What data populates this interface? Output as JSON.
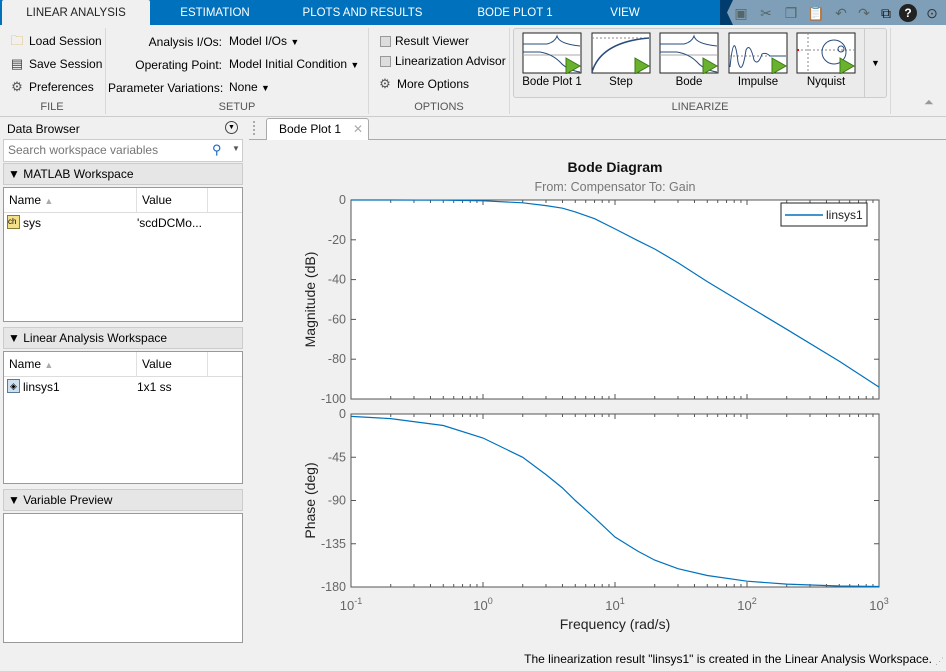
{
  "tabs": [
    {
      "label": "LINEAR ANALYSIS",
      "selected": true
    },
    {
      "label": "ESTIMATION"
    },
    {
      "label": "PLOTS AND RESULTS"
    },
    {
      "label": "BODE PLOT 1"
    },
    {
      "label": "VIEW"
    }
  ],
  "quick_access": [
    "save-icon",
    "cut-icon",
    "copy-icon",
    "paste-icon",
    "undo-icon",
    "redo-icon",
    "window-icon",
    "help-icon",
    "menu-icon"
  ],
  "file": {
    "section": "FILE",
    "load": "Load Session",
    "save": "Save Session",
    "prefs": "Preferences"
  },
  "setup": {
    "section": "SETUP",
    "io_label": "Analysis I/Os:",
    "io_value": "Model I/Os",
    "op_label": "Operating Point:",
    "op_value": "Model Initial Condition",
    "pv_label": "Parameter Variations:",
    "pv_value": "None"
  },
  "options": {
    "section": "OPTIONS",
    "result_viewer": "Result Viewer",
    "advisor": "Linearization Advisor",
    "more": "More Options"
  },
  "linearize": {
    "section": "LINEARIZE",
    "items": [
      "Bode Plot 1",
      "Step",
      "Bode",
      "Impulse",
      "Nyquist"
    ]
  },
  "data_browser": {
    "title": "Data Browser",
    "search_placeholder": "Search workspace variables",
    "matlab_ws": {
      "title": "MATLAB Workspace",
      "col_name": "Name",
      "col_value": "Value",
      "rows": [
        {
          "name": "sys",
          "value": "'scdDCMo..."
        }
      ]
    },
    "linear_ws": {
      "title": "Linear Analysis Workspace",
      "col_name": "Name",
      "col_value": "Value",
      "rows": [
        {
          "name": "linsys1",
          "value": "1x1 ss"
        }
      ]
    },
    "preview": {
      "title": "Variable Preview"
    }
  },
  "doc_tab": {
    "label": "Bode Plot 1"
  },
  "status": "The linearization result \"linsys1\" is created in the Linear Analysis Workspace.",
  "chart_data": {
    "type": "line",
    "title": "Bode Diagram",
    "subtitle": "From: Compensator  To: Gain",
    "xlabel": "Frequency  (rad/s)",
    "xscale": "log",
    "xlim": [
      0.1,
      1000
    ],
    "xticks": [
      {
        "base": "10",
        "exp": "-1"
      },
      {
        "base": "10",
        "exp": "0"
      },
      {
        "base": "10",
        "exp": "1"
      },
      {
        "base": "10",
        "exp": "2"
      },
      {
        "base": "10",
        "exp": "3"
      }
    ],
    "legend": {
      "entries": [
        "linsys1"
      ],
      "placement": "top-right"
    },
    "color": "#0072bd",
    "frequency": [
      0.1,
      0.2,
      0.5,
      1,
      2,
      3,
      4,
      5,
      7,
      10,
      15,
      20,
      30,
      50,
      100,
      200,
      500,
      1000
    ],
    "magnitude": {
      "ylabel": "Magnitude (dB)",
      "ylim": [
        -100,
        0
      ],
      "yticks": [
        0,
        -20,
        -40,
        -60,
        -80,
        -100
      ],
      "values": [
        0,
        -0.01,
        -0.09,
        -0.4,
        -1.4,
        -2.8,
        -4.1,
        -6.0,
        -9.4,
        -14.5,
        -20.5,
        -24.6,
        -31.5,
        -41,
        -53,
        -65,
        -81,
        -94
      ]
    },
    "phase": {
      "ylabel": "Phase (deg)",
      "ylim": [
        -180,
        0
      ],
      "yticks": [
        0,
        -45,
        -90,
        -135,
        -180
      ],
      "values": [
        -2.5,
        -4.8,
        -12,
        -25,
        -45,
        -63,
        -77,
        -90,
        -108,
        -128,
        -143,
        -152,
        -161,
        -168,
        -174,
        -177,
        -179,
        -179.5
      ]
    }
  }
}
